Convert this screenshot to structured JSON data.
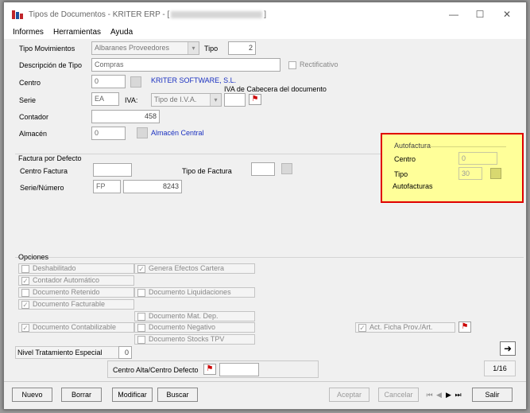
{
  "window": {
    "title_prefix": "Tipos de Documentos - KRITER ERP - [",
    "title_suffix": "]",
    "minimize": "—",
    "maximize": "☐",
    "close": "✕"
  },
  "menu": [
    "Informes",
    "Herramientas",
    "Ayuda"
  ],
  "form": {
    "tipo_movimientos_label": "Tipo Movimientos",
    "tipo_movimientos_value": "Albaranes Proveedores",
    "tipo_label": "Tipo",
    "tipo_value": "2",
    "descripcion_label": "Descripción de Tipo",
    "descripcion_value": "Compras",
    "rectificativo_label": "Rectificativo",
    "centro_label": "Centro",
    "centro_value": "0",
    "centro_name": "KRITER SOFTWARE, S.L.",
    "iva_cabecera_label": "IVA de Cabecera del documento",
    "serie_label": "Serie",
    "serie_value": "EA",
    "iva_label": "IVA:",
    "iva_value": "Tipo de I.V.A.",
    "contador_label": "Contador",
    "contador_value": "458",
    "almacen_label": "Almacén",
    "almacen_value": "0",
    "almacen_name": "Almacén Central"
  },
  "factura": {
    "section_label": "Factura por Defecto",
    "centro_factura_label": "Centro Factura",
    "tipo_factura_label": "Tipo de Factura",
    "serie_numero_label": "Serie/Número",
    "serie_value": "FP",
    "numero_value": "8243"
  },
  "autofactura": {
    "group_label": "Autofactura",
    "centro_label": "Centro",
    "centro_value": "0",
    "tipo_label": "Tipo",
    "tipo_value": "30",
    "footer_label": "Autofacturas"
  },
  "opciones": {
    "section_label": "Opciones",
    "deshabilitado": "Deshabilitado",
    "genera_efectos": "Genera Efectos Cartera",
    "contador_automatico": "Contador Automático",
    "documento_retenido": "Documento Retenido",
    "documento_liquidaciones": "Documento Liquidaciones",
    "documento_facturable": "Documento Facturable",
    "documento_mat_dep": "Documento Mat. Dep.",
    "documento_contabilizable": "Documento Contabilizable",
    "documento_negativo": "Documento Negativo",
    "documento_stocks_tpv": "Documento Stocks TPV",
    "act_ficha": "Act. Ficha Prov./Art.",
    "nivel_label": "Nivel Tratamiento Especial",
    "nivel_value": "0",
    "centro_alta_label": "Centro Alta/Centro Defecto"
  },
  "record_counter": "1/16",
  "buttons": {
    "nuevo": "Nuevo",
    "borrar": "Borrar",
    "modificar": "Modificar",
    "buscar": "Buscar",
    "aceptar": "Aceptar",
    "cancelar": "Cancelar",
    "salir": "Salir"
  },
  "colors": {
    "highlight_fill": "#ffff99",
    "highlight_border": "#e00000",
    "link": "#1a30c0"
  }
}
